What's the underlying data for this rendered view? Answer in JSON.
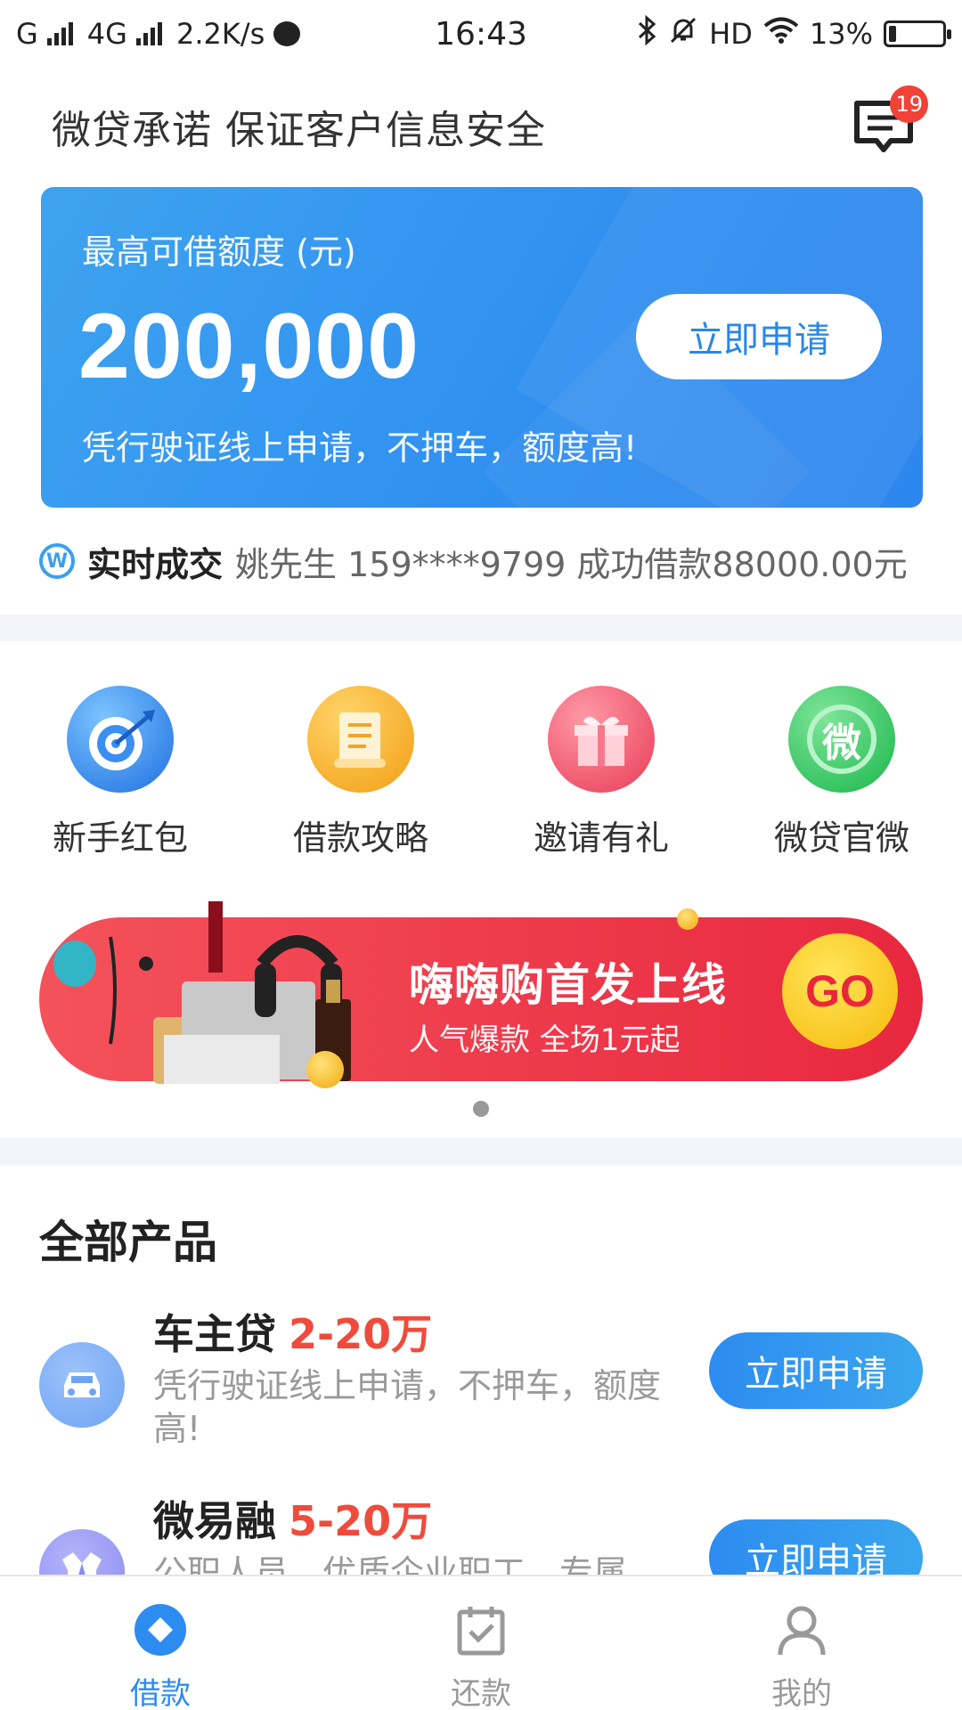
{
  "status_bar": {
    "carrier_left": "G",
    "network": "4G",
    "speed": "2.2K/s",
    "time": "16:43",
    "hd": "HD",
    "battery": "13%",
    "battery_level": 0.13
  },
  "header": {
    "title": "微贷承诺  保证客户信息安全",
    "message_badge": "19",
    "icon": "message-icon"
  },
  "hero": {
    "label": "最高可借额度 (元)",
    "amount": "200,000",
    "description": "凭行驶证线上申请，不押车，额度高!",
    "apply_label": "立即申请"
  },
  "ticker": {
    "icon_text": "W",
    "label": "实时成交",
    "text": "姚先生 159****9799 成功借款88000.00元"
  },
  "quick_links": [
    {
      "label": "新手红包",
      "icon": "target-icon"
    },
    {
      "label": "借款攻略",
      "icon": "scroll-icon"
    },
    {
      "label": "邀请有礼",
      "icon": "gift-icon"
    },
    {
      "label": "微贷官微",
      "icon": "wechat-icon",
      "glyph": "微"
    }
  ],
  "banner": {
    "title": "嗨嗨购首发上线",
    "subtitle": "人气爆款  全场1元起",
    "go_label": "GO",
    "carousel_index": 1,
    "carousel_total": 1
  },
  "products_section": {
    "title": "全部产品",
    "items": [
      {
        "name": "车主贷",
        "range": "2-20万",
        "description": "凭行驶证线上申请，不押车，额度高!",
        "apply_label": "立即申请",
        "icon": "car-icon",
        "icon_color": "#6fa4f4"
      },
      {
        "name": "微易融",
        "range": "5-20万",
        "description": "公职人员、优质企业职工，专属",
        "apply_label": "立即申请",
        "icon": "shirt-icon",
        "icon_color": "#8b8cf0"
      }
    ]
  },
  "tabbar": {
    "tabs": [
      {
        "label": "借款",
        "icon": "loan-icon",
        "active": true
      },
      {
        "label": "还款",
        "icon": "calendar-check-icon",
        "active": false
      },
      {
        "label": "我的",
        "icon": "user-icon",
        "active": false
      }
    ]
  },
  "colors": {
    "accent": "#2d8cf0",
    "highlight": "#ef4b3c",
    "banner": "#e8283f"
  }
}
